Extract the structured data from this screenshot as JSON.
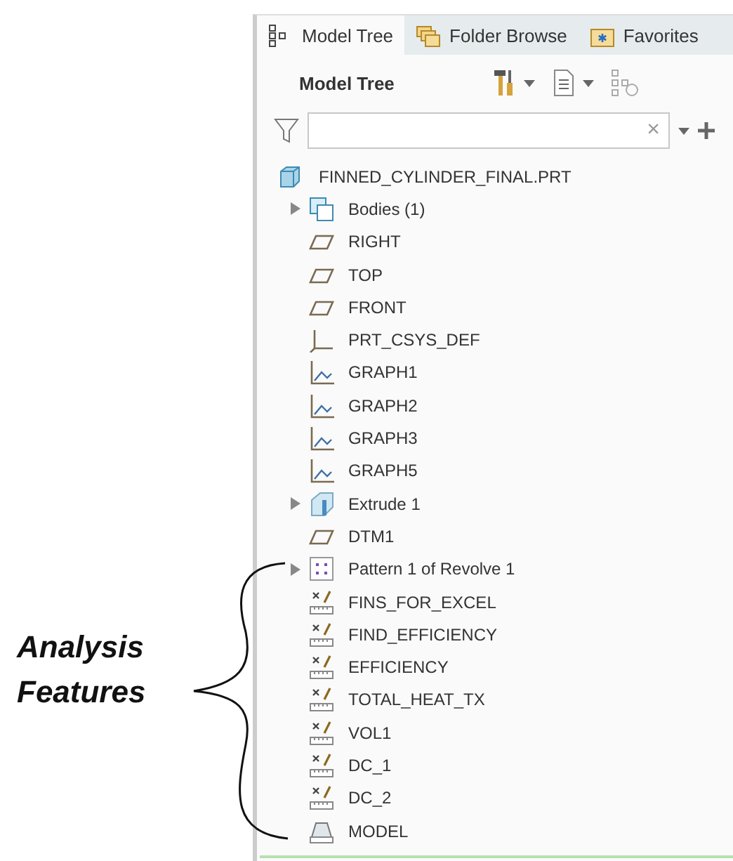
{
  "annotation": {
    "lines": [
      "Analysis",
      "Features"
    ]
  },
  "tabs": [
    {
      "label": "Model Tree",
      "kind": "tree",
      "selected": true
    },
    {
      "label": "Folder Browse",
      "kind": "folders",
      "selected": false
    },
    {
      "label": "Favorites",
      "kind": "favorites",
      "selected": false
    }
  ],
  "header": {
    "title": "Model Tree"
  },
  "filter": {
    "clear": "×"
  },
  "tree": [
    {
      "label": "FINNED_CYLINDER_FINAL.PRT",
      "kind": "part",
      "children": [
        {
          "label": "Bodies (1)",
          "kind": "bodies",
          "expanded": false
        },
        {
          "label": "RIGHT",
          "kind": "plane"
        },
        {
          "label": "TOP",
          "kind": "plane"
        },
        {
          "label": "FRONT",
          "kind": "plane"
        },
        {
          "label": "PRT_CSYS_DEF",
          "kind": "csys"
        },
        {
          "label": "GRAPH1",
          "kind": "graph"
        },
        {
          "label": "GRAPH2",
          "kind": "graph"
        },
        {
          "label": "GRAPH3",
          "kind": "graph"
        },
        {
          "label": "GRAPH5",
          "kind": "graph"
        },
        {
          "label": "Extrude 1",
          "kind": "extrude",
          "expanded": false
        },
        {
          "label": "DTM1",
          "kind": "plane"
        },
        {
          "label": "Pattern 1 of Revolve 1",
          "kind": "pattern",
          "expanded": false
        },
        {
          "label": "FINS_FOR_EXCEL",
          "kind": "analysis"
        },
        {
          "label": "FIND_EFFICIENCY",
          "kind": "analysis"
        },
        {
          "label": "EFFICIENCY",
          "kind": "analysis"
        },
        {
          "label": "TOTAL_HEAT_TX",
          "kind": "analysis"
        },
        {
          "label": "VOL1",
          "kind": "analysis"
        },
        {
          "label": "DC_1",
          "kind": "analysis"
        },
        {
          "label": "DC_2",
          "kind": "analysis"
        },
        {
          "label": "MODEL",
          "kind": "model"
        }
      ]
    }
  ]
}
